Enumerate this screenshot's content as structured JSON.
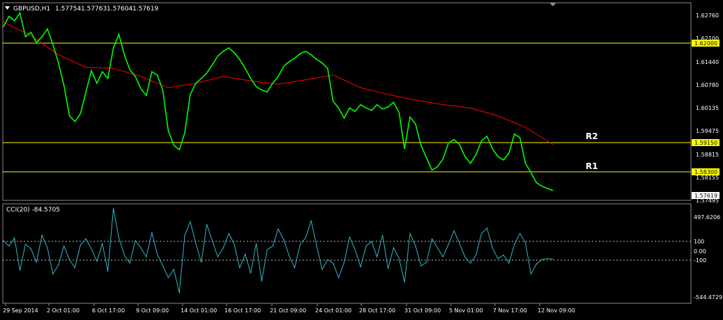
{
  "chart_data": [
    {
      "type": "line",
      "header": {
        "menu_icon": "triangle-down-icon",
        "symbol_timeframe": "GBPUSD,H1",
        "open": "1.57754",
        "high": "1.57763",
        "low": "1.57604",
        "close": "1.57619"
      },
      "ylim": [
        1.5735,
        1.6313
      ],
      "y_ticks": [
        "1.62760",
        "1.62100",
        "1.61440",
        "1.60780",
        "1.60135",
        "1.59475",
        "1.58815",
        "1.58155",
        "1.57495"
      ],
      "current_price": "1.57619",
      "horizontal_levels": [
        {
          "price": 1.62,
          "label": "1.62000",
          "tag": ""
        },
        {
          "price": 1.5915,
          "label": "1.59150",
          "tag": "R2"
        },
        {
          "price": 1.583,
          "label": "1.58300",
          "tag": "R1"
        }
      ],
      "moving_average": {
        "color": "#ff0000",
        "x": [
          0,
          5,
          10,
          15,
          20,
          25,
          30,
          35,
          40,
          45,
          50,
          55,
          60,
          65,
          70,
          75,
          80,
          85,
          90,
          95,
          100
        ],
        "y": [
          1.6258,
          1.6218,
          1.6162,
          1.6125,
          1.6122,
          1.6098,
          1.6065,
          1.6078,
          1.6098,
          1.6085,
          1.6075,
          1.6088,
          1.6102,
          1.6065,
          1.6045,
          1.6028,
          1.6015,
          1.6005,
          1.5982,
          1.5948,
          1.5898
        ]
      },
      "price_series": {
        "color": "#00ff00",
        "x": [
          0,
          1,
          2,
          3,
          4,
          5,
          6,
          7,
          8,
          9,
          10,
          11,
          12,
          13,
          14,
          15,
          16,
          17,
          18,
          19,
          20,
          21,
          22,
          23,
          24,
          25,
          26,
          27,
          28,
          29,
          30,
          31,
          32,
          33,
          34,
          35,
          36,
          37,
          38,
          39,
          40,
          41,
          42,
          43,
          44,
          45,
          46,
          47,
          48,
          49,
          50,
          51,
          52,
          53,
          54,
          55,
          56,
          57,
          58,
          59,
          60,
          61,
          62,
          63,
          64,
          65,
          66,
          67,
          68,
          69,
          70,
          71,
          72,
          73,
          74,
          75,
          76,
          77,
          78,
          79,
          80,
          81,
          82,
          83,
          84,
          85,
          86,
          87,
          88,
          89,
          90,
          91,
          92,
          93,
          94,
          95,
          96,
          97,
          98,
          99,
          100
        ],
        "y": [
          1.6245,
          1.6275,
          1.6262,
          1.6285,
          1.6215,
          1.6228,
          1.6198,
          1.6215,
          1.6238,
          1.6192,
          1.6138,
          1.6072,
          1.5982,
          1.5965,
          1.5988,
          1.6052,
          1.6115,
          1.6078,
          1.6112,
          1.6092,
          1.6182,
          1.6222,
          1.6162,
          1.6118,
          1.6098,
          1.6062,
          1.6042,
          1.6112,
          1.6102,
          1.6058,
          1.5938,
          1.5895,
          1.5882,
          1.5932,
          1.6045,
          1.6078,
          1.6092,
          1.6108,
          1.6132,
          1.6158,
          1.6172,
          1.6182,
          1.6168,
          1.6148,
          1.6122,
          1.6092,
          1.6068,
          1.6058,
          1.6052,
          1.6078,
          1.6098,
          1.6128,
          1.6142,
          1.6152,
          1.6165,
          1.6172,
          1.6162,
          1.6148,
          1.6138,
          1.6122,
          1.6025,
          1.6005,
          1.5975,
          1.6005,
          1.5995,
          1.6015,
          1.6005,
          1.5998,
          1.6015,
          1.6002,
          1.6008,
          1.6022,
          1.5992,
          1.5885,
          1.5978,
          1.5958,
          1.5895,
          1.5858,
          1.5822,
          1.5832,
          1.5855,
          1.5902,
          1.5912,
          1.5898,
          1.5862,
          1.5842,
          1.5868,
          1.5908,
          1.5922,
          1.5885,
          1.5862,
          1.5852,
          1.5872,
          1.5928,
          1.5918,
          1.5842,
          1.5815,
          1.5785,
          1.5775,
          1.5768,
          1.5762
        ]
      },
      "labels_for_series": "",
      "x_ticks": [
        "29 Sep 2014",
        "2 Oct 01:00",
        "6 Oct 17:00",
        "9 Oct 09:00",
        "14 Oct 01:00",
        "16 Oct 17:00",
        "21 Oct 09:00",
        "24 Oct 01:00",
        "28 Oct 17:00",
        "31 Oct 09:00",
        "5 Nov 01:00",
        "7 Nov 17:00",
        "12 Nov 09:00"
      ],
      "grid": false
    },
    {
      "type": "line",
      "indicator_label": "CCI(20) -84.5705",
      "ylim": [
        -544.4729,
        497.6206
      ],
      "y_ticks": [
        "497.6206",
        "100",
        "0.00",
        "-100",
        "-544.4729"
      ],
      "reference_levels": [
        100,
        -100
      ],
      "cci_series": {
        "color": "#30b8c8",
        "x": [
          0,
          1,
          2,
          3,
          4,
          5,
          6,
          7,
          8,
          9,
          10,
          11,
          12,
          13,
          14,
          15,
          16,
          17,
          18,
          19,
          20,
          21,
          22,
          23,
          24,
          25,
          26,
          27,
          28,
          29,
          30,
          31,
          32,
          33,
          34,
          35,
          36,
          37,
          38,
          39,
          40,
          41,
          42,
          43,
          44,
          45,
          46,
          47,
          48,
          49,
          50,
          51,
          52,
          53,
          54,
          55,
          56,
          57,
          58,
          59,
          60,
          61,
          62,
          63,
          64,
          65,
          66,
          67,
          68,
          69,
          70,
          71,
          72,
          73,
          74,
          75,
          76,
          77,
          78,
          79,
          80,
          81,
          82,
          83,
          84,
          85,
          86,
          87,
          88,
          89,
          90,
          91,
          92,
          93,
          94,
          95,
          96,
          97,
          98,
          99,
          100
        ],
        "y": [
          120,
          60,
          150,
          -210,
          80,
          30,
          -120,
          180,
          40,
          -250,
          -150,
          60,
          -90,
          -180,
          70,
          140,
          30,
          -110,
          90,
          -220,
          480,
          150,
          -40,
          -130,
          120,
          40,
          -60,
          210,
          -30,
          -160,
          -290,
          -200,
          -460,
          180,
          330,
          90,
          -120,
          300,
          120,
          -60,
          40,
          200,
          80,
          -180,
          -30,
          -240,
          90,
          -330,
          20,
          60,
          250,
          130,
          -50,
          -180,
          80,
          150,
          340,
          60,
          -200,
          -90,
          -130,
          -290,
          -120,
          160,
          20,
          -170,
          60,
          110,
          -60,
          180,
          -190,
          40,
          -80,
          -340,
          200,
          60,
          -160,
          -120,
          140,
          40,
          -60,
          80,
          230,
          90,
          -60,
          -130,
          -40,
          200,
          260,
          40,
          -80,
          -40,
          -130,
          80,
          200,
          100,
          -250,
          -140,
          -90,
          -80,
          -85
        ]
      },
      "x_ticks": [
        "29 Sep 2014",
        "2 Oct 01:00",
        "6 Oct 17:00",
        "9 Oct 09:00",
        "14 Oct 01:00",
        "16 Oct 17:00",
        "21 Oct 09:00",
        "24 Oct 01:00",
        "28 Oct 17:00",
        "31 Oct 09:00",
        "5 Nov 01:00",
        "7 Nov 17:00",
        "12 Nov 09:00"
      ],
      "grid": false
    }
  ],
  "colors": {
    "background": "#000000",
    "frame": "#8c8c8c",
    "level_line": "#ffff00",
    "level_tag_bg": "#ffff00",
    "current_tag_bg": "#ffffff",
    "text": "#ffffff",
    "dotted": "#bfbfbf"
  }
}
